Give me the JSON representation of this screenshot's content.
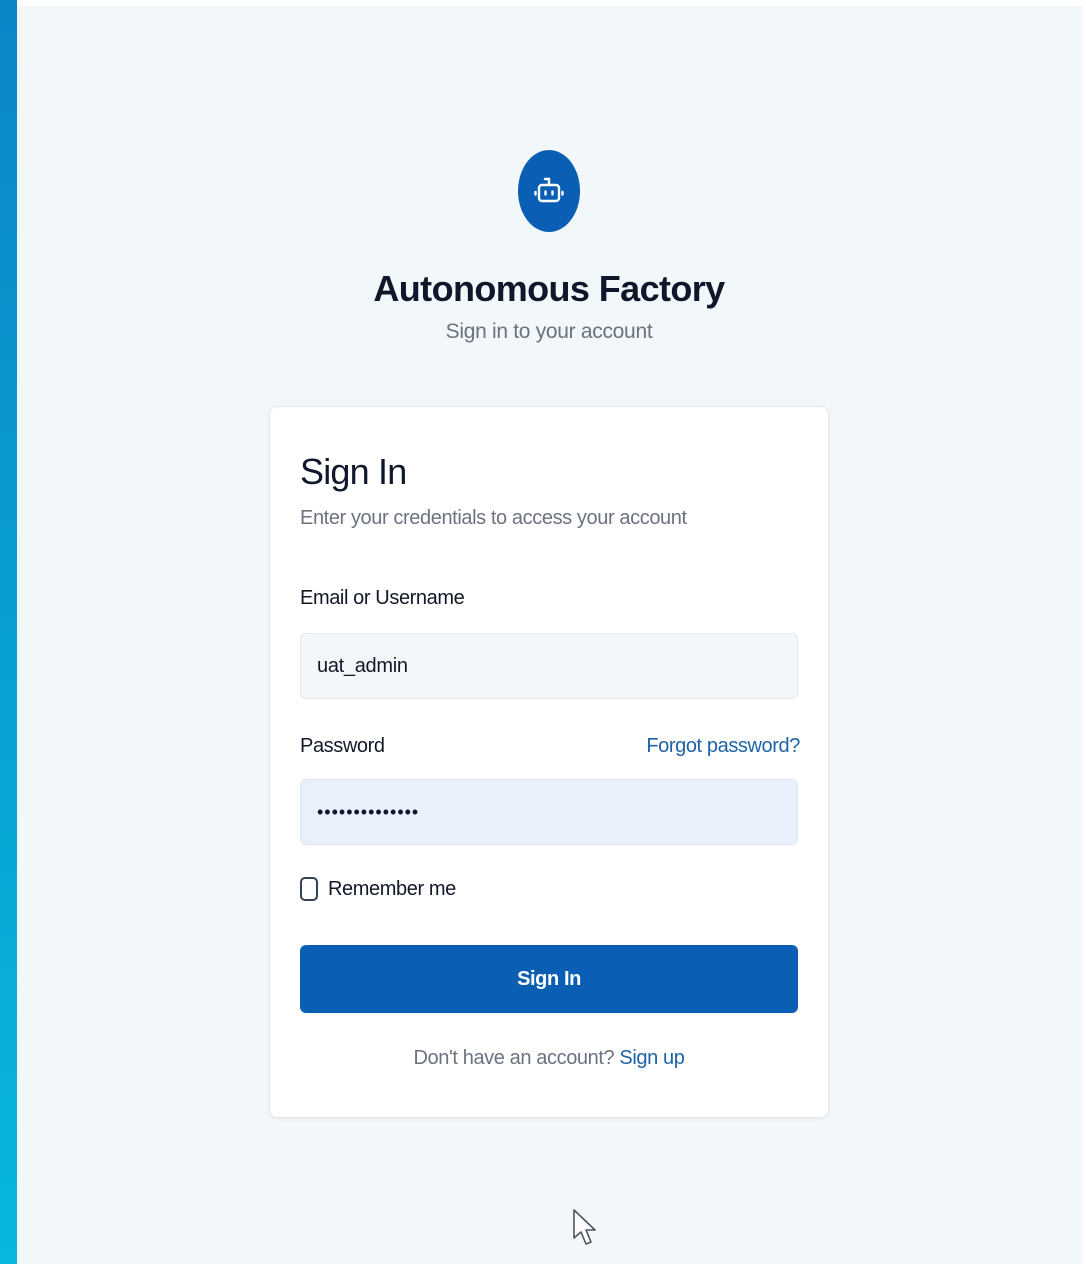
{
  "header": {
    "logo_icon": "robot-icon",
    "title": "Autonomous Factory",
    "subtitle": "Sign in to your account"
  },
  "card": {
    "title": "Sign In",
    "description": "Enter your credentials to access your account",
    "email": {
      "label": "Email or Username",
      "value": "uat_admin"
    },
    "password": {
      "label": "Password",
      "value": "••••••••••••••",
      "forgot_link": "Forgot password?"
    },
    "remember": {
      "label": "Remember me",
      "checked": false
    },
    "submit_label": "Sign In",
    "signup": {
      "prompt": "Don't have an account?",
      "link": "Sign up"
    }
  },
  "colors": {
    "accent": "#0a5fb4",
    "link": "#1e63a8",
    "background": "#f2f7f9",
    "sidebar_gradient": [
      "#0a86c9",
      "#06b8dc"
    ]
  }
}
